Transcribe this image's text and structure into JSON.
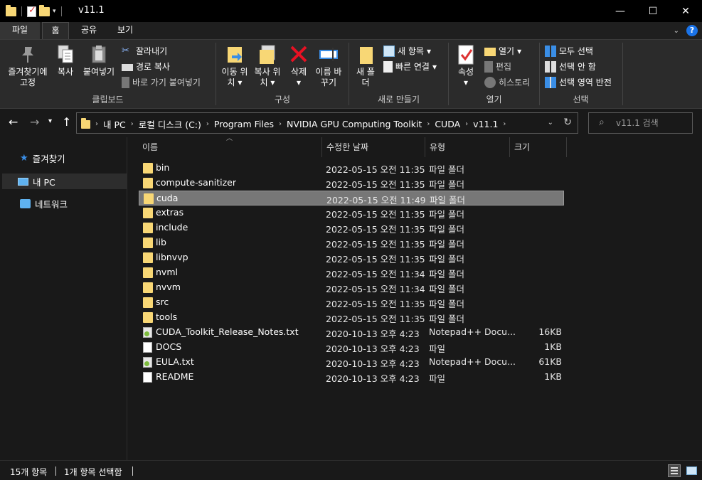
{
  "window": {
    "title": "v11.1",
    "min_glyph": "—",
    "max_glyph": "☐",
    "close_glyph": "✕"
  },
  "ribbon_tabs": {
    "file": "파일",
    "home": "홈",
    "share": "공유",
    "view": "보기"
  },
  "ribbon": {
    "clipboard": {
      "label": "클립보드",
      "pin": "즐겨찾기에 고정",
      "copy": "복사",
      "paste": "붙여넣기",
      "cut": "잘라내기",
      "copy_path": "경로 복사",
      "paste_shortcut": "바로 가기 붙여넣기"
    },
    "organize": {
      "label": "구성",
      "move_to": "이동 위치",
      "copy_to": "복사 위치",
      "delete": "삭제",
      "rename": "이름 바꾸기"
    },
    "new": {
      "label": "새로 만들기",
      "new_folder": "새 폴더",
      "new_item": "새 항목",
      "easy_access": "빠른 연결"
    },
    "open": {
      "label": "열기",
      "properties": "속성",
      "open": "열기",
      "edit": "편집",
      "history": "히스토리"
    },
    "select": {
      "label": "선택",
      "select_all": "모두 선택",
      "select_none": "선택 안 함",
      "invert": "선택 영역 반전"
    }
  },
  "address": {
    "crumbs": [
      "내 PC",
      "로컬 디스크 (C:)",
      "Program Files",
      "NVIDIA GPU Computing Toolkit",
      "CUDA",
      "v11.1"
    ],
    "search_placeholder": "v11.1 검색"
  },
  "navpane": {
    "quick_access": "즐겨찾기",
    "this_pc": "내 PC",
    "network": "네트워크"
  },
  "columns": {
    "name": "이름",
    "date": "수정한 날짜",
    "type": "유형",
    "size": "크기"
  },
  "files": [
    {
      "name": "bin",
      "date": "2022-05-15 오전 11:35",
      "type": "파일 폴더",
      "size": "",
      "kind": "folder"
    },
    {
      "name": "compute-sanitizer",
      "date": "2022-05-15 오전 11:35",
      "type": "파일 폴더",
      "size": "",
      "kind": "folder"
    },
    {
      "name": "cuda",
      "date": "2022-05-15 오전 11:49",
      "type": "파일 폴더",
      "size": "",
      "kind": "folder"
    },
    {
      "name": "extras",
      "date": "2022-05-15 오전 11:35",
      "type": "파일 폴더",
      "size": "",
      "kind": "folder"
    },
    {
      "name": "include",
      "date": "2022-05-15 오전 11:35",
      "type": "파일 폴더",
      "size": "",
      "kind": "folder"
    },
    {
      "name": "lib",
      "date": "2022-05-15 오전 11:35",
      "type": "파일 폴더",
      "size": "",
      "kind": "folder"
    },
    {
      "name": "libnvvp",
      "date": "2022-05-15 오전 11:35",
      "type": "파일 폴더",
      "size": "",
      "kind": "folder"
    },
    {
      "name": "nvml",
      "date": "2022-05-15 오전 11:34",
      "type": "파일 폴더",
      "size": "",
      "kind": "folder"
    },
    {
      "name": "nvvm",
      "date": "2022-05-15 오전 11:34",
      "type": "파일 폴더",
      "size": "",
      "kind": "folder"
    },
    {
      "name": "src",
      "date": "2022-05-15 오전 11:35",
      "type": "파일 폴더",
      "size": "",
      "kind": "folder"
    },
    {
      "name": "tools",
      "date": "2022-05-15 오전 11:35",
      "type": "파일 폴더",
      "size": "",
      "kind": "folder"
    },
    {
      "name": "CUDA_Toolkit_Release_Notes.txt",
      "date": "2020-10-13 오후 4:23",
      "type": "Notepad++ Docu...",
      "size": "16KB",
      "kind": "txt"
    },
    {
      "name": "DOCS",
      "date": "2020-10-13 오후 4:23",
      "type": "파일",
      "size": "1KB",
      "kind": "file"
    },
    {
      "name": "EULA.txt",
      "date": "2020-10-13 오후 4:23",
      "type": "Notepad++ Docu...",
      "size": "61KB",
      "kind": "txt"
    },
    {
      "name": "README",
      "date": "2020-10-13 오후 4:23",
      "type": "파일",
      "size": "1KB",
      "kind": "file"
    }
  ],
  "selected_index": 2,
  "status": {
    "count": "15개 항목",
    "selected": "1개 항목 선택함"
  },
  "colors": {
    "background": "#191919",
    "ribbon": "#2b2b2b",
    "folder": "#f8d775",
    "selection": "#777777",
    "help": "#1a73e8"
  }
}
